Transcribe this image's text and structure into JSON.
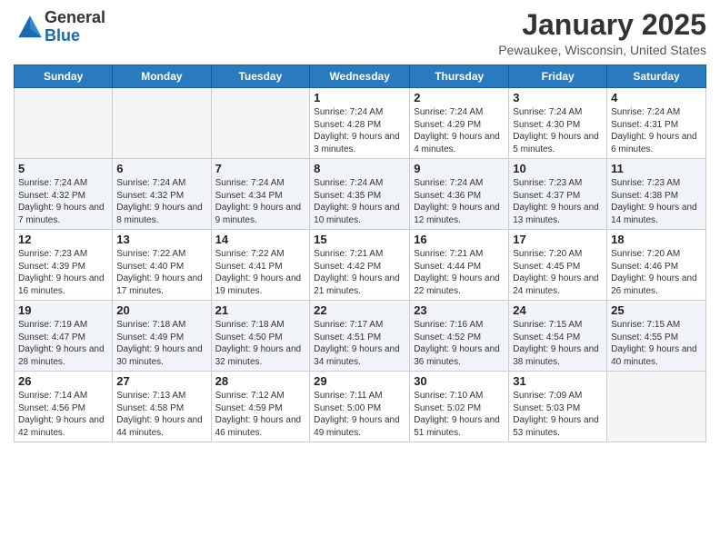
{
  "logo": {
    "general": "General",
    "blue": "Blue"
  },
  "title": {
    "month": "January 2025",
    "location": "Pewaukee, Wisconsin, United States"
  },
  "weekdays": [
    "Sunday",
    "Monday",
    "Tuesday",
    "Wednesday",
    "Thursday",
    "Friday",
    "Saturday"
  ],
  "weeks": [
    [
      {
        "day": "",
        "info": ""
      },
      {
        "day": "",
        "info": ""
      },
      {
        "day": "",
        "info": ""
      },
      {
        "day": "1",
        "info": "Sunrise: 7:24 AM\nSunset: 4:28 PM\nDaylight: 9 hours and 3 minutes."
      },
      {
        "day": "2",
        "info": "Sunrise: 7:24 AM\nSunset: 4:29 PM\nDaylight: 9 hours and 4 minutes."
      },
      {
        "day": "3",
        "info": "Sunrise: 7:24 AM\nSunset: 4:30 PM\nDaylight: 9 hours and 5 minutes."
      },
      {
        "day": "4",
        "info": "Sunrise: 7:24 AM\nSunset: 4:31 PM\nDaylight: 9 hours and 6 minutes."
      }
    ],
    [
      {
        "day": "5",
        "info": "Sunrise: 7:24 AM\nSunset: 4:32 PM\nDaylight: 9 hours and 7 minutes."
      },
      {
        "day": "6",
        "info": "Sunrise: 7:24 AM\nSunset: 4:32 PM\nDaylight: 9 hours and 8 minutes."
      },
      {
        "day": "7",
        "info": "Sunrise: 7:24 AM\nSunset: 4:34 PM\nDaylight: 9 hours and 9 minutes."
      },
      {
        "day": "8",
        "info": "Sunrise: 7:24 AM\nSunset: 4:35 PM\nDaylight: 9 hours and 10 minutes."
      },
      {
        "day": "9",
        "info": "Sunrise: 7:24 AM\nSunset: 4:36 PM\nDaylight: 9 hours and 12 minutes."
      },
      {
        "day": "10",
        "info": "Sunrise: 7:23 AM\nSunset: 4:37 PM\nDaylight: 9 hours and 13 minutes."
      },
      {
        "day": "11",
        "info": "Sunrise: 7:23 AM\nSunset: 4:38 PM\nDaylight: 9 hours and 14 minutes."
      }
    ],
    [
      {
        "day": "12",
        "info": "Sunrise: 7:23 AM\nSunset: 4:39 PM\nDaylight: 9 hours and 16 minutes."
      },
      {
        "day": "13",
        "info": "Sunrise: 7:22 AM\nSunset: 4:40 PM\nDaylight: 9 hours and 17 minutes."
      },
      {
        "day": "14",
        "info": "Sunrise: 7:22 AM\nSunset: 4:41 PM\nDaylight: 9 hours and 19 minutes."
      },
      {
        "day": "15",
        "info": "Sunrise: 7:21 AM\nSunset: 4:42 PM\nDaylight: 9 hours and 21 minutes."
      },
      {
        "day": "16",
        "info": "Sunrise: 7:21 AM\nSunset: 4:44 PM\nDaylight: 9 hours and 22 minutes."
      },
      {
        "day": "17",
        "info": "Sunrise: 7:20 AM\nSunset: 4:45 PM\nDaylight: 9 hours and 24 minutes."
      },
      {
        "day": "18",
        "info": "Sunrise: 7:20 AM\nSunset: 4:46 PM\nDaylight: 9 hours and 26 minutes."
      }
    ],
    [
      {
        "day": "19",
        "info": "Sunrise: 7:19 AM\nSunset: 4:47 PM\nDaylight: 9 hours and 28 minutes."
      },
      {
        "day": "20",
        "info": "Sunrise: 7:18 AM\nSunset: 4:49 PM\nDaylight: 9 hours and 30 minutes."
      },
      {
        "day": "21",
        "info": "Sunrise: 7:18 AM\nSunset: 4:50 PM\nDaylight: 9 hours and 32 minutes."
      },
      {
        "day": "22",
        "info": "Sunrise: 7:17 AM\nSunset: 4:51 PM\nDaylight: 9 hours and 34 minutes."
      },
      {
        "day": "23",
        "info": "Sunrise: 7:16 AM\nSunset: 4:52 PM\nDaylight: 9 hours and 36 minutes."
      },
      {
        "day": "24",
        "info": "Sunrise: 7:15 AM\nSunset: 4:54 PM\nDaylight: 9 hours and 38 minutes."
      },
      {
        "day": "25",
        "info": "Sunrise: 7:15 AM\nSunset: 4:55 PM\nDaylight: 9 hours and 40 minutes."
      }
    ],
    [
      {
        "day": "26",
        "info": "Sunrise: 7:14 AM\nSunset: 4:56 PM\nDaylight: 9 hours and 42 minutes."
      },
      {
        "day": "27",
        "info": "Sunrise: 7:13 AM\nSunset: 4:58 PM\nDaylight: 9 hours and 44 minutes."
      },
      {
        "day": "28",
        "info": "Sunrise: 7:12 AM\nSunset: 4:59 PM\nDaylight: 9 hours and 46 minutes."
      },
      {
        "day": "29",
        "info": "Sunrise: 7:11 AM\nSunset: 5:00 PM\nDaylight: 9 hours and 49 minutes."
      },
      {
        "day": "30",
        "info": "Sunrise: 7:10 AM\nSunset: 5:02 PM\nDaylight: 9 hours and 51 minutes."
      },
      {
        "day": "31",
        "info": "Sunrise: 7:09 AM\nSunset: 5:03 PM\nDaylight: 9 hours and 53 minutes."
      },
      {
        "day": "",
        "info": ""
      }
    ]
  ]
}
